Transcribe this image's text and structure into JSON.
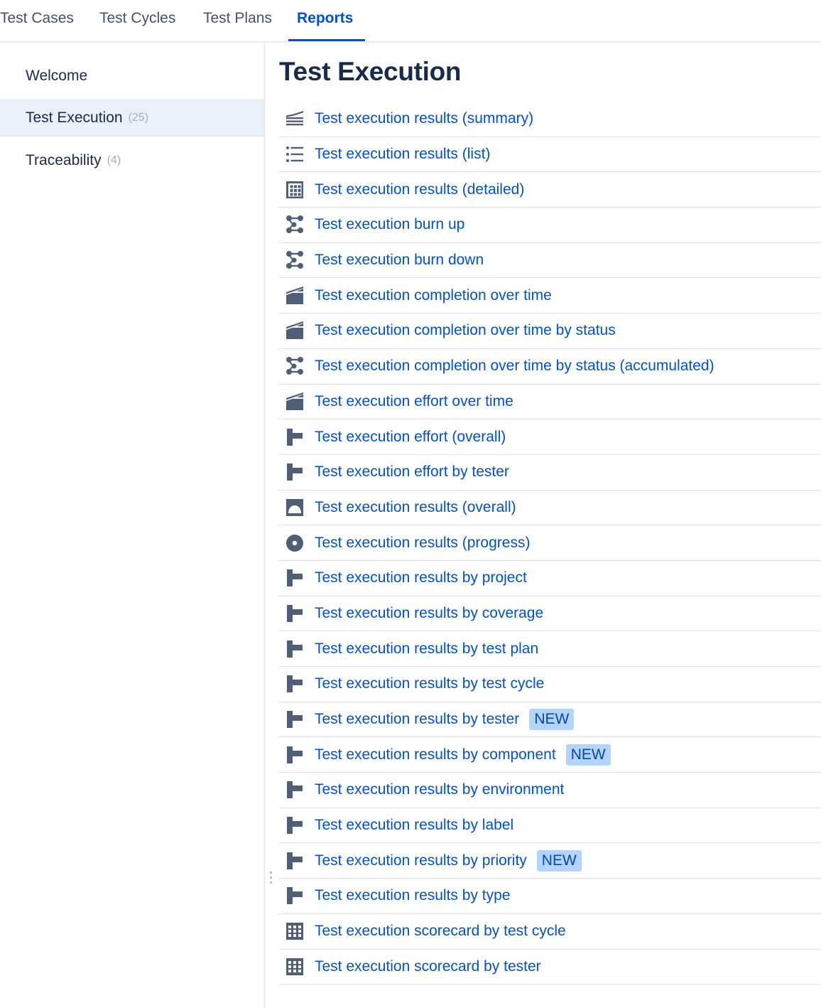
{
  "tabs": [
    {
      "label": "Test Cases",
      "active": false
    },
    {
      "label": "Test Cycles",
      "active": false
    },
    {
      "label": "Test Plans",
      "active": false
    },
    {
      "label": "Reports",
      "active": true
    }
  ],
  "sidebar": {
    "items": [
      {
        "label": "Welcome",
        "count": null,
        "selected": false
      },
      {
        "label": "Test Execution",
        "count": "(25)",
        "selected": true
      },
      {
        "label": "Traceability",
        "count": "(4)",
        "selected": false
      }
    ]
  },
  "main": {
    "title": "Test Execution",
    "reports": [
      {
        "icon": "stacked-lines-icon",
        "label": "Test execution results (summary)",
        "badge": null
      },
      {
        "icon": "list-icon",
        "label": "Test execution results (list)",
        "badge": null
      },
      {
        "icon": "grid-table-icon",
        "label": "Test execution results (detailed)",
        "badge": null
      },
      {
        "icon": "burn-chart-icon",
        "label": "Test execution burn up",
        "badge": null
      },
      {
        "icon": "burn-chart-icon",
        "label": "Test execution burn down",
        "badge": null
      },
      {
        "icon": "area-chart-icon",
        "label": "Test execution completion over time",
        "badge": null
      },
      {
        "icon": "area-chart-icon",
        "label": "Test execution completion over time by status",
        "badge": null
      },
      {
        "icon": "burn-chart-icon",
        "label": "Test execution completion over time by status (accumulated)",
        "badge": null
      },
      {
        "icon": "area-chart-icon",
        "label": "Test execution effort over time",
        "badge": null
      },
      {
        "icon": "bar-chart-icon",
        "label": "Test execution effort (overall)",
        "badge": null
      },
      {
        "icon": "bar-chart-icon",
        "label": "Test execution effort by tester",
        "badge": null
      },
      {
        "icon": "gauge-icon",
        "label": "Test execution results (overall)",
        "badge": null
      },
      {
        "icon": "donut-icon",
        "label": "Test execution results (progress)",
        "badge": null
      },
      {
        "icon": "bar-chart-icon",
        "label": "Test execution results by project",
        "badge": null
      },
      {
        "icon": "bar-chart-icon",
        "label": "Test execution results by coverage",
        "badge": null
      },
      {
        "icon": "bar-chart-icon",
        "label": "Test execution results by test plan",
        "badge": null
      },
      {
        "icon": "bar-chart-icon",
        "label": "Test execution results by test cycle",
        "badge": null
      },
      {
        "icon": "bar-chart-icon",
        "label": "Test execution results by tester",
        "badge": "NEW"
      },
      {
        "icon": "bar-chart-icon",
        "label": "Test execution results by component",
        "badge": "NEW"
      },
      {
        "icon": "bar-chart-icon",
        "label": "Test execution results by environment",
        "badge": null
      },
      {
        "icon": "bar-chart-icon",
        "label": "Test execution results by label",
        "badge": null
      },
      {
        "icon": "bar-chart-icon",
        "label": "Test execution results by priority",
        "badge": "NEW"
      },
      {
        "icon": "bar-chart-icon",
        "label": "Test execution results by type",
        "badge": null
      },
      {
        "icon": "scorecard-icon",
        "label": "Test execution scorecard by test cycle",
        "badge": null
      },
      {
        "icon": "scorecard-icon",
        "label": "Test execution scorecard by tester",
        "badge": null
      }
    ]
  },
  "colors": {
    "link": "#0052cc",
    "heading": "#172b4d",
    "tab": "#42526e",
    "selected_bg": "#e9f0fa",
    "badge_bg": "#b3d4ff",
    "badge_text": "#0747a6",
    "icon": "#505f79"
  }
}
